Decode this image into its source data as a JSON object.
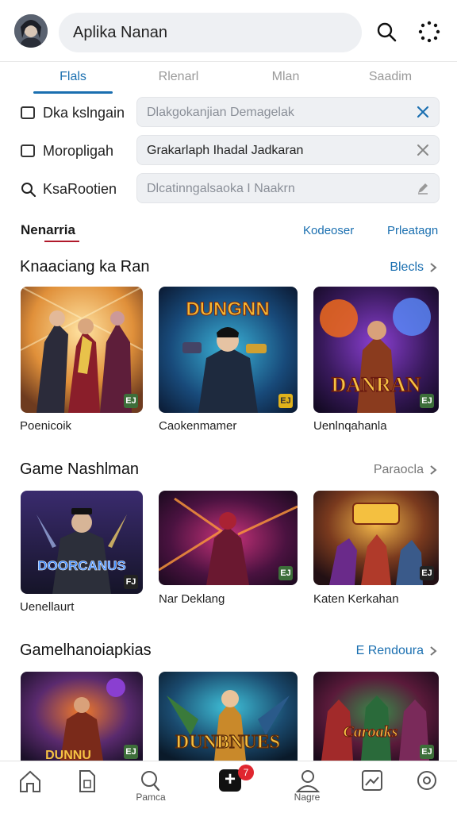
{
  "header": {
    "search_text": "Aplika Nanan"
  },
  "tabs": [
    {
      "label": "Flals",
      "active": true
    },
    {
      "label": "Rlenarl",
      "active": false
    },
    {
      "label": "Mlan",
      "active": false
    },
    {
      "label": "Saadim",
      "active": false
    }
  ],
  "filters": [
    {
      "icon": "checkbox-icon",
      "label": "Dka kslngain",
      "value": "Dlakgokanjian Demagelak",
      "filled": false,
      "clear_icon": "close-icon"
    },
    {
      "icon": "checkbox-icon",
      "label": "Moropligah",
      "value": "Grakarlaph Ihadal Jadkaran",
      "filled": true,
      "clear_icon": "close-icon"
    },
    {
      "icon": "search-icon",
      "label": "KsaRootien",
      "value": "Dlcatinngalsaoka I Naakrn",
      "filled": false,
      "clear_icon": "edit-icon"
    }
  ],
  "subnav": {
    "main": "Nenarria",
    "link1": "Kodeoser",
    "link2": "Prleatagn"
  },
  "sections": [
    {
      "title": "Knaaciang ka Ran",
      "more": "Blecls",
      "more_blue": true,
      "cards": [
        {
          "caption": "Poenicoik",
          "tag": "EJ"
        },
        {
          "caption": "Caokenmamer",
          "tag": "EJ"
        },
        {
          "caption": "Uenlnqahanla",
          "tag": "EJ"
        }
      ]
    },
    {
      "title": "Game Nashlman",
      "more": "Paraocla",
      "more_blue": false,
      "cards": [
        {
          "caption": "Uenellaurt",
          "tag": "FJ"
        },
        {
          "caption": "Nar Deklang",
          "tag": "EJ"
        },
        {
          "caption": "Katen Kerkahan",
          "tag": "EJ"
        }
      ]
    },
    {
      "title": "Gamelhanoiapkias",
      "more": "E Rendoura",
      "more_blue": true,
      "cards": [
        {
          "caption": "",
          "tag": "EJ"
        },
        {
          "caption": "",
          "tag": ""
        },
        {
          "caption": "",
          "tag": "EJ"
        }
      ]
    }
  ],
  "card_texts": {
    "c1b": "DUNGNN",
    "c1c": "DANRAN",
    "c2a": "DOORCANUS",
    "c3a": "DUNNU",
    "c3b": "DUNBNUES",
    "c3c": "Caroaks"
  },
  "bottom_nav": {
    "items": [
      {
        "icon": "home-icon",
        "label": ""
      },
      {
        "icon": "sim-card-icon",
        "label": ""
      },
      {
        "icon": "search-icon",
        "label": "Pamca"
      },
      {
        "icon": "add-icon",
        "label": ""
      },
      {
        "icon": "profile-icon",
        "label": "Nagre"
      },
      {
        "icon": "gallery-icon",
        "label": ""
      },
      {
        "icon": "settings-icon",
        "label": ""
      }
    ],
    "badge": "7"
  },
  "colors": {
    "accent": "#1a6fb0",
    "underline_red": "#b0192a",
    "badge": "#e0262f"
  }
}
